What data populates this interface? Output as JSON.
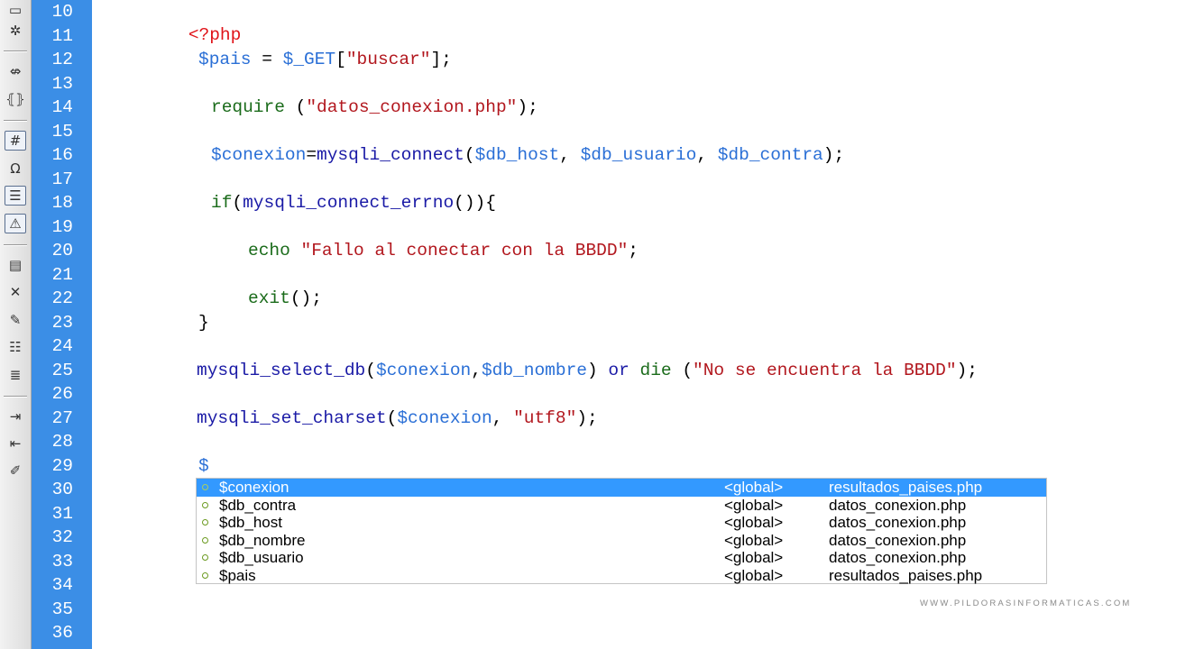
{
  "toolbar": {
    "icons": [
      "collapse-icon",
      "expand-icon",
      "select-parent-tag-icon",
      "balance-braces-icon",
      "line-numbers-icon",
      "highlight-invalid-code-icon",
      "word-wrap-icon",
      "syntax-error-alerts-icon",
      "apply-comment-icon",
      "remove-comment-icon",
      "wrap-tag-icon",
      "recent-snippets-icon",
      "move-css-icon",
      "indent-code-icon",
      "outdent-code-icon",
      "format-source-code-icon"
    ],
    "glyphs": [
      "▭",
      "✲",
      "⇎",
      "⦃⦄",
      "#",
      "Ω",
      "☰",
      "⚠",
      "▤",
      "✕",
      "✎",
      "☷",
      "≣",
      "⇥",
      "⇤",
      "✐"
    ]
  },
  "gutter": {
    "line_numbers": [
      "10",
      "11",
      "12",
      "13",
      "14",
      "15",
      "16",
      "17",
      "18",
      "19",
      "20",
      "21",
      "22",
      "23",
      "24",
      "25",
      "26",
      "27",
      "28",
      "29",
      "30",
      "31",
      "32",
      "33",
      "34",
      "35",
      "36"
    ]
  },
  "code": {
    "php_open": "<?php",
    "l12_var": "$pais",
    "l12_eq": " = ",
    "l12_get": "$_GET",
    "l12_br_open": "[",
    "l12_str": "\"buscar\"",
    "l12_end": "];",
    "l14_kw": "require ",
    "l14_open": "(",
    "l14_str": "\"datos_conexion.php\"",
    "l14_end": ");",
    "l16_var": "$conexion",
    "l16_eq": "=",
    "l16_fn": "mysqli_connect",
    "l16_open": "(",
    "l16_a1": "$db_host",
    "l16_c1": ", ",
    "l16_a2": "$db_usuario",
    "l16_c2": ", ",
    "l16_a3": "$db_contra",
    "l16_end": ");",
    "l18_if": "if",
    "l18_open": "(",
    "l18_fn": "mysqli_connect_errno",
    "l18_end": "()){",
    "l20_echo": "echo ",
    "l20_str": "\"Fallo al conectar con la BBDD\"",
    "l20_end": ";",
    "l22_fn": "exit",
    "l22_end": "();",
    "l23_brace": "}",
    "l25_fn": "mysqli_select_db",
    "l25_open": "(",
    "l25_a1": "$conexion",
    "l25_c1": ",",
    "l25_a2": "$db_nombre",
    "l25_close": ") ",
    "l25_or": "or ",
    "l25_die": "die ",
    "l25_open2": "(",
    "l25_str": "\"No se encuentra la BBDD\"",
    "l25_end": ");",
    "l27_fn": "mysqli_set_charset",
    "l27_open": "(",
    "l27_a1": "$conexion",
    "l27_c1": ", ",
    "l27_str": "\"utf8\"",
    "l27_end": ");",
    "l29_cursor": "$"
  },
  "autocomplete": {
    "items": [
      {
        "name": "$conexion",
        "scope": "<global>",
        "file": "resultados_paises.php"
      },
      {
        "name": "$db_contra",
        "scope": "<global>",
        "file": "datos_conexion.php"
      },
      {
        "name": "$db_host",
        "scope": "<global>",
        "file": "datos_conexion.php"
      },
      {
        "name": "$db_nombre",
        "scope": "<global>",
        "file": "datos_conexion.php"
      },
      {
        "name": "$db_usuario",
        "scope": "<global>",
        "file": "datos_conexion.php"
      },
      {
        "name": "$pais",
        "scope": "<global>",
        "file": "resultados_paises.php"
      }
    ]
  },
  "watermark": "WWW.PILDORASINFORMATICAS.COM",
  "colors": {
    "gutter_bg": "#3b8ee6",
    "selection": "#3399ff",
    "keyword": "#1a1aa6",
    "variable": "#2a6fd6",
    "string": "#b2171e",
    "php_tag": "#e0141a",
    "echo": "#1a6b1a"
  }
}
